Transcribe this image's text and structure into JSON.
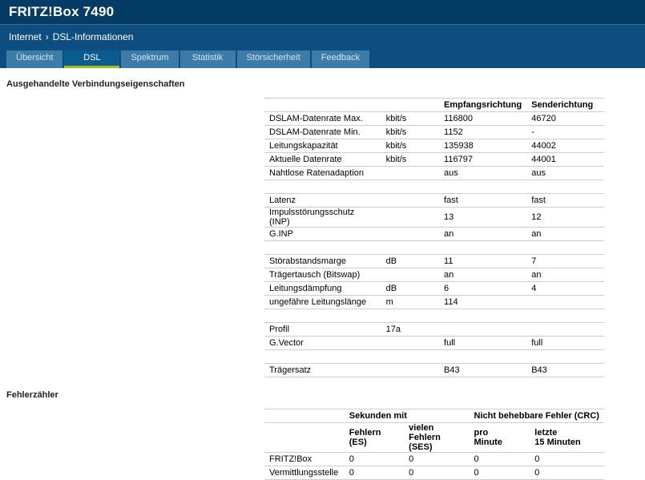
{
  "colors": {
    "header_bg": "#053c66",
    "nav_bg": "#0e4d7f",
    "tab_bg": "#3d7ca9",
    "tab_active_bg": "#0a5c8e",
    "accent_green": "#9cc11e",
    "border": "#cccccc"
  },
  "header": {
    "title": "FRITZ!Box 7490"
  },
  "breadcrumb": {
    "section": "Internet",
    "separator": "›",
    "page": "DSL-Informationen"
  },
  "tabs": [
    {
      "label": "Übersicht",
      "active": false
    },
    {
      "label": "DSL",
      "active": true
    },
    {
      "label": "Spektrum",
      "active": false
    },
    {
      "label": "Statistik",
      "active": false
    },
    {
      "label": "Störsicherheit",
      "active": false
    },
    {
      "label": "Feedback",
      "active": false
    }
  ],
  "connection_section": {
    "title": "Ausgehandelte Verbindungseigenschaften",
    "table": {
      "headers": [
        "",
        "",
        "Empfangsrichtung",
        "Senderichtung"
      ],
      "rows": [
        [
          "DSLAM-Datenrate Max.",
          "kbit/s",
          "116800",
          "46720"
        ],
        [
          "DSLAM-Datenrate Min.",
          "kbit/s",
          "1152",
          "-"
        ],
        [
          "Leitungskapazität",
          "kbit/s",
          "135938",
          "44002"
        ],
        [
          "Aktuelle Datenrate",
          "kbit/s",
          "116797",
          "44001"
        ],
        [
          "Nahtlose Ratenadaption",
          "",
          "aus",
          "aus"
        ],
        [
          "",
          "",
          "",
          ""
        ],
        [
          "Latenz",
          "",
          "fast",
          "fast"
        ],
        [
          "Impulsstörungsschutz (INP)",
          "",
          "13",
          "12"
        ],
        [
          "G.INP",
          "",
          "an",
          "an"
        ],
        [
          "",
          "",
          "",
          ""
        ],
        [
          "Störabstandsmarge",
          "dB",
          "11",
          "7"
        ],
        [
          "Trägertausch (Bitswap)",
          "",
          "an",
          "an"
        ],
        [
          "Leitungsdämpfung",
          "dB",
          "6",
          "4"
        ],
        [
          "ungefähre Leitungslänge",
          "m",
          "114",
          ""
        ],
        [
          "",
          "",
          "",
          ""
        ],
        [
          "Profil",
          "17a",
          "",
          ""
        ],
        [
          "G.Vector",
          "",
          "full",
          "full"
        ],
        [
          "",
          "",
          "",
          ""
        ],
        [
          "Trägersatz",
          "",
          "B43",
          "B43"
        ]
      ]
    }
  },
  "error_section": {
    "title": "Fehlerzähler",
    "table": {
      "group_headers": [
        "",
        "Sekunden mit",
        "Nicht behebbare Fehler (CRC)"
      ],
      "col_headers": [
        "",
        "Fehlern (ES)",
        "vielen\nFehlern (SES)",
        "pro\nMinute",
        "letzte\n15 Minuten"
      ],
      "rows": [
        [
          "FRITZ!Box",
          "0",
          "0",
          "0",
          "0"
        ],
        [
          "Vermittlungsstelle",
          "0",
          "0",
          "0",
          "0"
        ]
      ]
    }
  }
}
